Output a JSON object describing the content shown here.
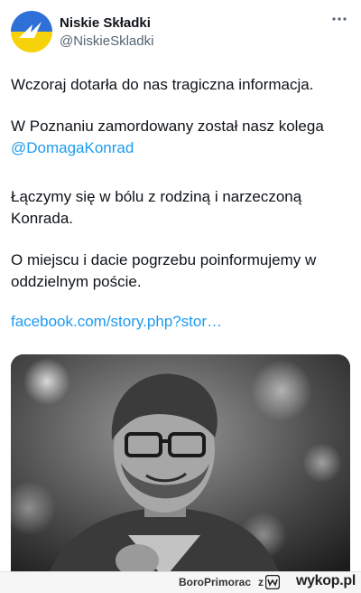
{
  "tweet": {
    "author_name": "Niskie Składki",
    "author_handle": "@NiskieSkladki",
    "paragraphs": {
      "p1": "Wczoraj dotarła do nas tragiczna informacja.",
      "p2": "W Poznaniu zamordowany został nasz kolega",
      "p2_mention": "@DomagaKonrad",
      "p3": "Łączymy się w bólu z rodziną i narzeczoną Konrada.",
      "p4": "O miejscu i dacie pogrzebu poinformujemy w oddzielnym poście.",
      "link": "facebook.com/story.php?stor…"
    },
    "colors": {
      "link": "#1d9bf0",
      "handle": "#536471",
      "avatar_top": "#2f6fd8",
      "avatar_bottom": "#f5d20a"
    }
  },
  "footer": {
    "user": "BoroPrimorac",
    "separator": "z",
    "site": "wykop.pl"
  },
  "icons": {
    "more": "more-dots-icon",
    "logo": "wykop-logo-icon"
  }
}
